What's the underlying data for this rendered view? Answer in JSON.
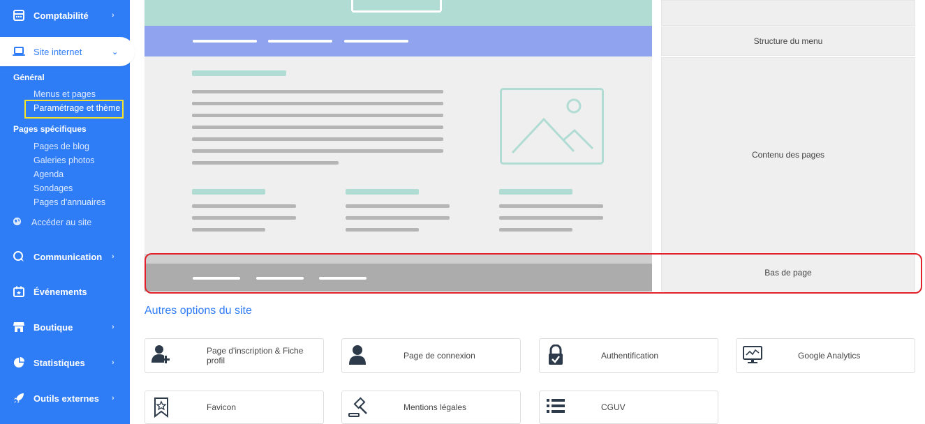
{
  "sidebar": {
    "comptabilite": "Comptabilité",
    "site_internet": "Site internet",
    "general": "Général",
    "menus_pages": "Menus et pages",
    "parametrage": "Paramétrage et thème",
    "pages_specifiques": "Pages spécifiques",
    "pages_blog": "Pages de blog",
    "galeries": "Galeries photos",
    "agenda": "Agenda",
    "sondages": "Sondages",
    "annuaires": "Pages d'annuaires",
    "acceder": "Accéder au site",
    "communication": "Communication",
    "evenements": "Événements",
    "boutique": "Boutique",
    "statistiques": "Statistiques",
    "outils": "Outils externes"
  },
  "sections": {
    "menu": "Structure du menu",
    "contenu": "Contenu des pages",
    "bas": "Bas de page"
  },
  "options": {
    "title": "Autres options du site",
    "items": [
      {
        "label": "Page d'inscription & Fiche profil",
        "icon": "user-add-icon"
      },
      {
        "label": "Page de connexion",
        "icon": "user-icon"
      },
      {
        "label": "Authentification",
        "icon": "lock-check-icon"
      },
      {
        "label": "Google Analytics",
        "icon": "analytics-monitor-icon"
      },
      {
        "label": "Favicon",
        "icon": "bookmark-star-icon"
      },
      {
        "label": "Mentions légales",
        "icon": "gavel-icon"
      },
      {
        "label": "CGUV",
        "icon": "list-icon"
      }
    ]
  },
  "colors": {
    "sidebar": "#2e7cf6",
    "teal": "#b0dcd3",
    "menu": "#8fa3ef",
    "highlight_yellow": "#f4e52a",
    "highlight_red": "#e0202b"
  }
}
